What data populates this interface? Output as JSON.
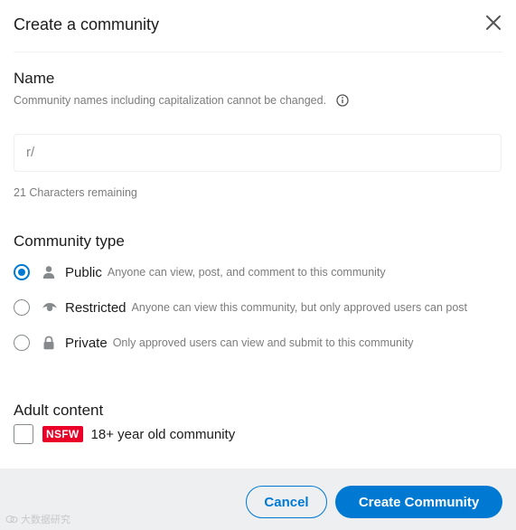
{
  "modal": {
    "title": "Create a community"
  },
  "name_section": {
    "label": "Name",
    "help_text": "Community names including capitalization cannot be changed.",
    "input_prefix": "r/",
    "input_value": "",
    "remaining_text": "21 Characters remaining"
  },
  "community_type": {
    "label": "Community type",
    "selected": "Public",
    "options": [
      {
        "name": "Public",
        "description": "Anyone can view, post, and comment to this community",
        "icon": "person-icon",
        "checked": true
      },
      {
        "name": "Restricted",
        "description": "Anyone can view this community, but only approved users can post",
        "icon": "eye-icon",
        "checked": false
      },
      {
        "name": "Private",
        "description": "Only approved users can view and submit to this community",
        "icon": "lock-icon",
        "checked": false
      }
    ]
  },
  "adult_content": {
    "label": "Adult content",
    "badge": "NSFW",
    "checkbox_label": "18+ year old community",
    "checked": false
  },
  "footer": {
    "cancel_label": "Cancel",
    "create_label": "Create Community"
  },
  "watermark": {
    "text": "大数据研究"
  },
  "colors": {
    "accent": "#0079d3",
    "nsfw": "#ea0027",
    "footer_bg": "#edeff1",
    "muted_text": "#7c7c7c"
  }
}
